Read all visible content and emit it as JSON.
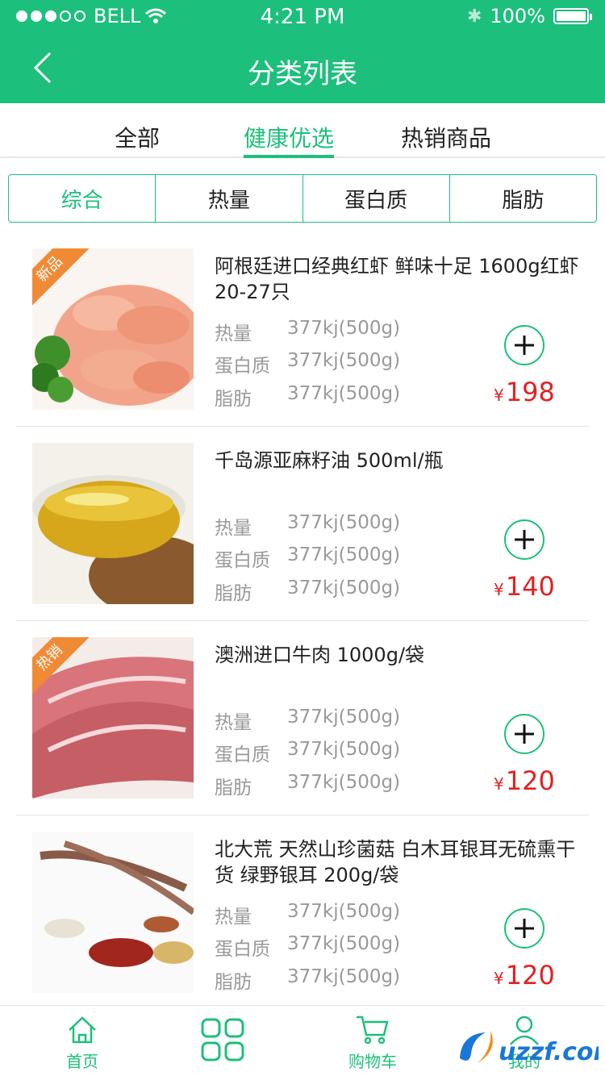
{
  "status": {
    "carrier": "BELL",
    "time": "4:21 PM",
    "battery": "100%"
  },
  "nav": {
    "title": "分类列表"
  },
  "tabs": [
    "全部",
    "健康优选",
    "热销商品"
  ],
  "sorts": [
    "综合",
    "热量",
    "蛋白质",
    "脂肪"
  ],
  "currency": "¥",
  "labels": {
    "calories": "热量",
    "protein": "蛋白质",
    "fat": "脂肪"
  },
  "products": [
    {
      "name": "阿根廷进口经典红虾  鲜味十足 1600g红虾20-27只",
      "badge": "新品",
      "calories": "377kj(500g)",
      "protein": "377kj(500g)",
      "fat": "377kj(500g)",
      "price": "198"
    },
    {
      "name": "千岛源亚麻籽油  500ml/瓶",
      "badge": "",
      "calories": "377kj(500g)",
      "protein": "377kj(500g)",
      "fat": "377kj(500g)",
      "price": "140"
    },
    {
      "name": "澳洲进口牛肉  1000g/袋",
      "badge": "热销",
      "calories": "377kj(500g)",
      "protein": "377kj(500g)",
      "fat": "377kj(500g)",
      "price": "120"
    },
    {
      "name": "北大荒 天然山珍菌菇 白木耳银耳无硫熏干货 绿野银耳     200g/袋",
      "badge": "",
      "calories": "377kj(500g)",
      "protein": "377kj(500g)",
      "fat": "377kj(500g)",
      "price": "120"
    }
  ],
  "tabbar": {
    "home": "首页",
    "cart": "购物车",
    "mine": "我的"
  },
  "watermark": "uzzf.com",
  "colors": {
    "brand": "#1dbf7c",
    "price": "#e02323",
    "badge": "#f08a35"
  }
}
